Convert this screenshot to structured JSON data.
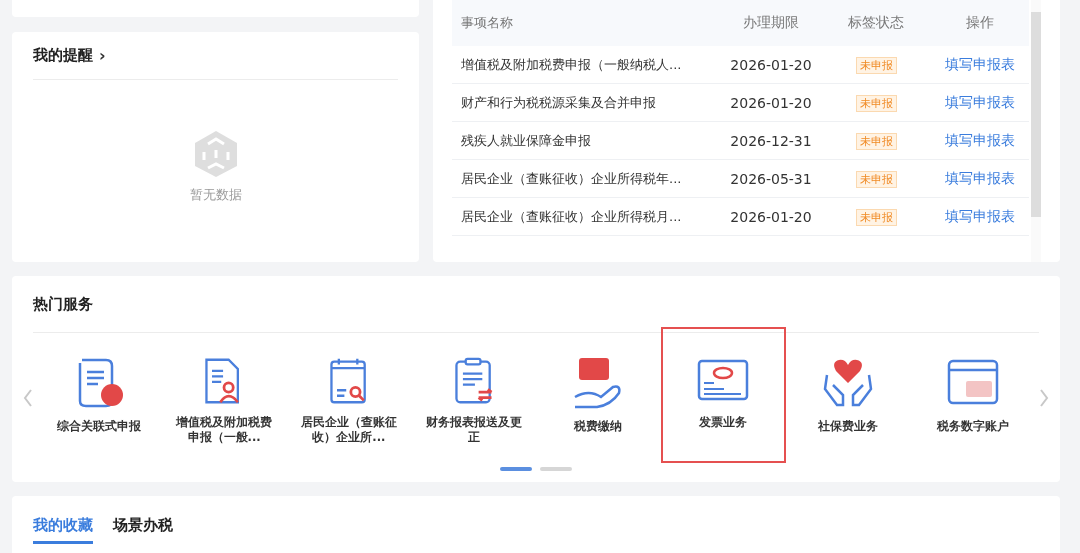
{
  "reminders": {
    "title": "我的提醒",
    "arrow": "›",
    "empty_text": "暂无数据"
  },
  "tasks": {
    "columns": [
      "事项名称",
      "办理期限",
      "标签状态",
      "操作"
    ],
    "rows": [
      {
        "name": "增值税及附加税费申报（一般纳税人...",
        "deadline": "2026-01-20",
        "status": "未申报",
        "action": "填写申报表"
      },
      {
        "name": "财产和行为税税源采集及合并申报",
        "deadline": "2026-01-20",
        "status": "未申报",
        "action": "填写申报表"
      },
      {
        "name": "残疾人就业保障金申报",
        "deadline": "2026-12-31",
        "status": "未申报",
        "action": "填写申报表"
      },
      {
        "name": "居民企业（查账征收）企业所得税年...",
        "deadline": "2026-05-31",
        "status": "未申报",
        "action": "填写申报表"
      },
      {
        "name": "居民企业（查账征收）企业所得税月...",
        "deadline": "2026-01-20",
        "status": "未申报",
        "action": "填写申报表"
      }
    ]
  },
  "hot_services": {
    "title": "热门服务",
    "items": [
      {
        "kind": "combined",
        "label": "综合关联式申报",
        "highlighted": false
      },
      {
        "kind": "vat",
        "label": "增值税及附加税费申报（一般...",
        "highlighted": false
      },
      {
        "kind": "income",
        "label": "居民企业（查账征收）企业所...",
        "highlighted": false
      },
      {
        "kind": "report",
        "label": "财务报表报送及更正",
        "highlighted": false
      },
      {
        "kind": "payment",
        "label": "税费缴纳",
        "highlighted": false
      },
      {
        "kind": "invoice",
        "label": "发票业务",
        "highlighted": true
      },
      {
        "kind": "social",
        "label": "社保费业务",
        "highlighted": false
      },
      {
        "kind": "account",
        "label": "税务数字账户",
        "highlighted": false
      }
    ],
    "pages": [
      {
        "selected": true
      },
      {
        "selected": false
      }
    ]
  },
  "bottom_tabs": [
    {
      "label": "我的收藏",
      "selected": true
    },
    {
      "label": "场景办税",
      "selected": false
    }
  ]
}
